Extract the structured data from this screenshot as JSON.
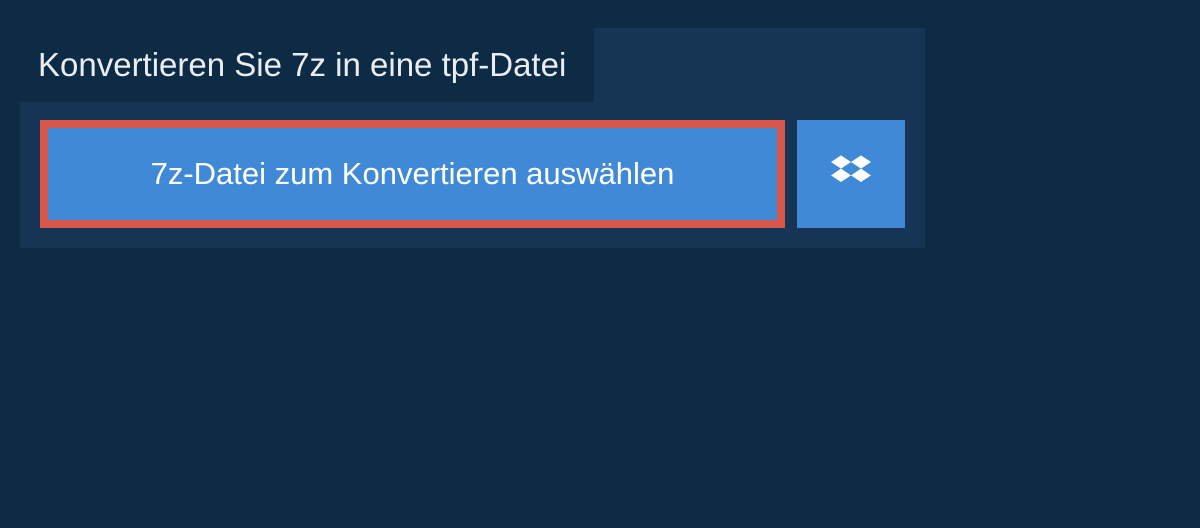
{
  "header": {
    "title": "Konvertieren Sie 7z in eine tpf-Datei"
  },
  "actions": {
    "select_file_label": "7z-Datei zum Konvertieren auswählen",
    "dropbox_icon": "dropbox"
  },
  "colors": {
    "background": "#0d2b45",
    "panel": "#163453",
    "button": "#4089d6",
    "highlight_border": "#d9564b"
  }
}
